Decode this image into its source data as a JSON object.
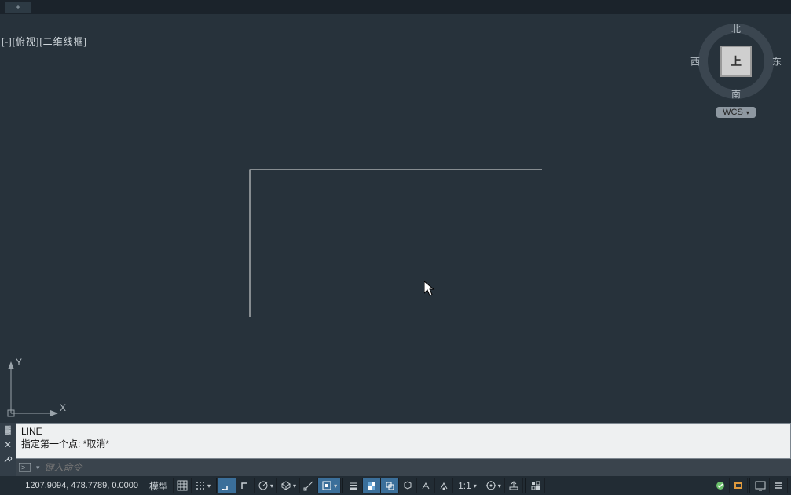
{
  "viewport_label": "[-][俯视][二维线框]",
  "viewcube": {
    "north": "北",
    "south": "南",
    "east": "东",
    "west": "西",
    "face": "上",
    "wcs": "WCS"
  },
  "ucs": {
    "x": "X",
    "y": "Y"
  },
  "command": {
    "history_line1": "LINE",
    "history_line2": "指定第一个点: *取消*",
    "placeholder": "键入命令"
  },
  "status": {
    "coords": "1207.9094, 478.7789, 0.0000",
    "model": "模型",
    "scale": "1:1"
  },
  "icons": {
    "newtab": "+",
    "drop": "▾",
    "close": "✕",
    "wrench": "🔧",
    "chev": "›"
  }
}
